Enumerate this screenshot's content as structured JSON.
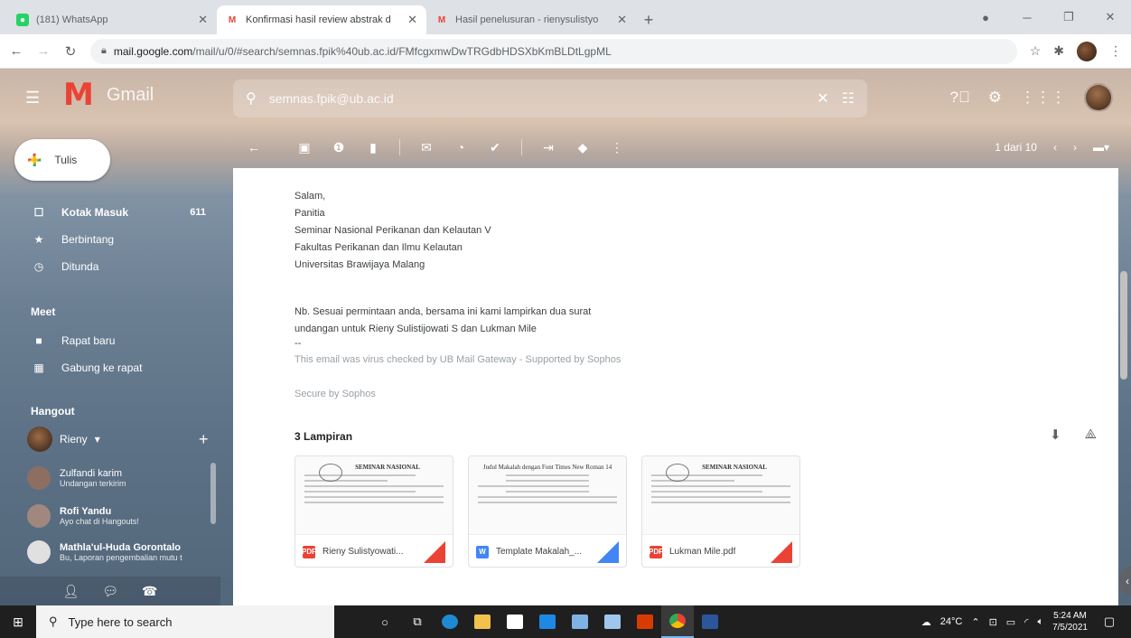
{
  "browser": {
    "tabs": [
      {
        "title": "(181) WhatsApp",
        "favicon": "whatsapp-icon",
        "color": "#25d366",
        "active": false
      },
      {
        "title": "Konfirmasi hasil review abstrak d",
        "favicon": "gmail-icon",
        "color": "#ea4335",
        "active": true
      },
      {
        "title": "Hasil penelusuran - rienysulistyo",
        "favicon": "gmail-icon",
        "color": "#ea4335",
        "active": false
      }
    ],
    "url_host": "mail.google.com",
    "url_path": "/mail/u/0/#search/semnas.fpik%40ub.ac.id/FMfcgxmwDwTRGdbHDSXbKmBLDtLgpML"
  },
  "gmail": {
    "brand": "Gmail",
    "search_value": "semnas.fpik@ub.ac.id",
    "pager": "1 dari 10",
    "compose_label": "Tulis",
    "nav": [
      {
        "label": "Kotak Masuk",
        "count": "611",
        "icon": "inbox-icon",
        "bold": true
      },
      {
        "label": "Berbintang",
        "count": "",
        "icon": "star-icon",
        "bold": false
      },
      {
        "label": "Ditunda",
        "count": "",
        "icon": "clock-icon",
        "bold": false
      }
    ],
    "meet": {
      "title": "Meet",
      "items": [
        {
          "label": "Rapat baru",
          "icon": "video-icon"
        },
        {
          "label": "Gabung ke rapat",
          "icon": "keyboard-icon"
        }
      ]
    },
    "hangout": {
      "title": "Hangout",
      "user": "Rieny",
      "contacts": [
        {
          "name": "Zulfandi karim",
          "message": "Undangan terkirim",
          "bold": false,
          "color": "#8d6e63"
        },
        {
          "name": "Rofi Yandu",
          "message": "Ayo chat di Hangouts!",
          "bold": true,
          "color": "#a1887f"
        },
        {
          "name": "Mathla'ul-Huda Gorontalo",
          "message": "Bu, Laporan pengembalian mutu t",
          "bold": true,
          "color": "#e0e0e0"
        }
      ]
    }
  },
  "email": {
    "signature": [
      "Salam,",
      "Panitia",
      "Seminar Nasional Perikanan dan Kelautan V",
      "Fakultas Perikanan dan Ilmu Kelautan",
      "Universitas Brawijaya Malang"
    ],
    "note": [
      "Nb. Sesuai permintaan anda, bersama ini kami lampirkan dua surat",
      "undangan untuk Rieny Sulistijowati S dan Lukman Mile"
    ],
    "dash": "--",
    "virus_check": "This email was virus checked by UB Mail Gateway - Supported by Sophos",
    "secure": "Secure by Sophos",
    "attachments_title": "3 Lampiran",
    "attachments": [
      {
        "name": "Rieny Sulistyowati...",
        "type": "PDF",
        "color": "#ea4335",
        "thumb_header": "SEMINAR NASIONAL",
        "corner_color": "#ea4335"
      },
      {
        "name": "Template Makalah_...",
        "type": "W",
        "color": "#4285f4",
        "thumb_header": "Judul Makalah dengan Font Times New Roman 14",
        "corner_color": "#4285f4"
      },
      {
        "name": "Lukman Mile.pdf",
        "type": "PDF",
        "color": "#ea4335",
        "thumb_header": "SEMINAR NASIONAL",
        "corner_color": "#ea4335"
      }
    ]
  },
  "taskbar": {
    "search_placeholder": "Type here to search",
    "weather": "24°C",
    "time": "5:24 AM",
    "date": "7/5/2021"
  }
}
